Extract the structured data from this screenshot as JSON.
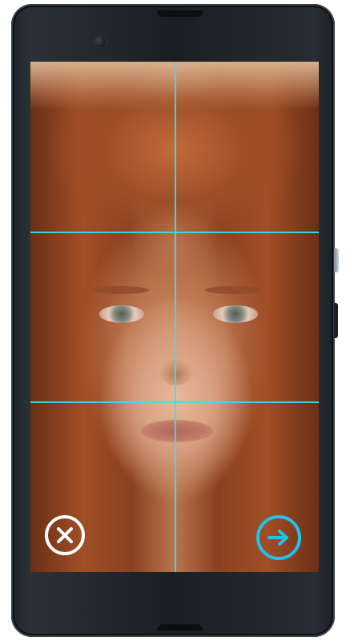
{
  "app": {
    "screen": "face-symmetry-preview"
  },
  "colors": {
    "grid_line": "#2ee6f0",
    "next_button": "#1ec3ee",
    "cancel_button": "#ffffff",
    "phone_body": "#1d2328"
  },
  "icons": {
    "cancel": "close-x-icon",
    "next": "arrow-right-icon"
  },
  "overlay": {
    "grid": "3x2"
  }
}
